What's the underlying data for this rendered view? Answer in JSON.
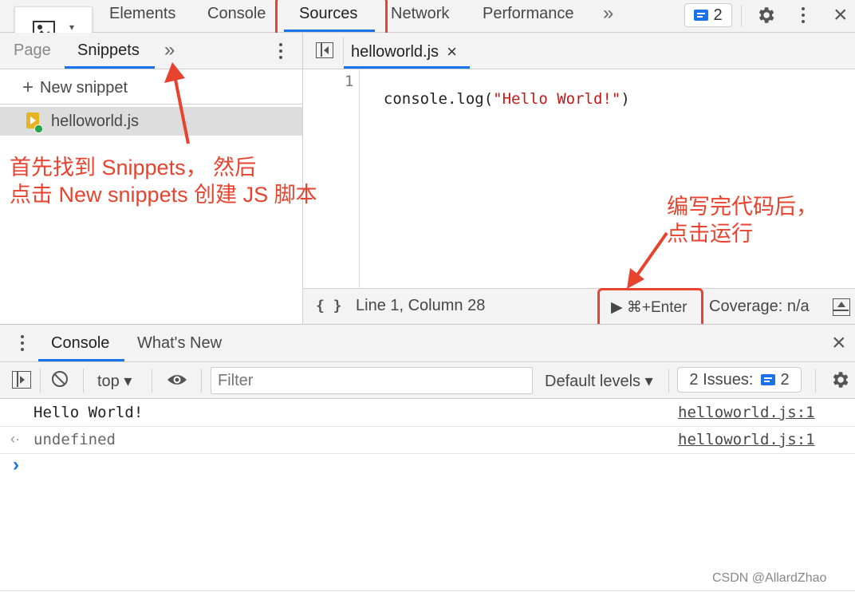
{
  "top_tabs": [
    "Elements",
    "Console",
    "Sources",
    "Network",
    "Performance"
  ],
  "top_overflow": "»",
  "issues_count": "2",
  "nav_tabs": {
    "page": "Page",
    "snippets": "Snippets",
    "overflow": "»"
  },
  "new_snippet": {
    "plus": "+",
    "label": "New snippet"
  },
  "snippet_file": "helloworld.js",
  "editor": {
    "tab_label": "helloworld.js",
    "close": "×",
    "line_number": "1",
    "code_plain": "console.log(",
    "code_string": "\"Hello World!\"",
    "code_end": ")"
  },
  "statusbar": {
    "braces": "{ }",
    "position": "Line 1, Column 28",
    "run": "▶ ⌘+Enter",
    "coverage": "Coverage: n/a"
  },
  "drawer": {
    "tabs": [
      "Console",
      "What's New"
    ],
    "close": "×"
  },
  "console_toolbar": {
    "context": "top ▾",
    "filter_placeholder": "Filter",
    "levels": "Default levels ▾",
    "issues_label": "2 Issues:",
    "issues_count": "2"
  },
  "console_rows": [
    {
      "prefix": "",
      "text": "Hello World!",
      "source": "helloworld.js:1"
    },
    {
      "prefix": "‹·",
      "text": "undefined",
      "source": "helloworld.js:1"
    }
  ],
  "prompt_symbol": "›",
  "annotations": {
    "left_line1": "首先找到 Snippets， 然后",
    "left_line2": "点击 New snippets 创建 JS 脚本",
    "right_line1": "编写完代码后，",
    "right_line2": "点击运行"
  },
  "watermark": "CSDN @AllardZhao",
  "colors": {
    "accent": "#1a73e8",
    "annotation": "#e8432e",
    "string": "#c41a16"
  }
}
